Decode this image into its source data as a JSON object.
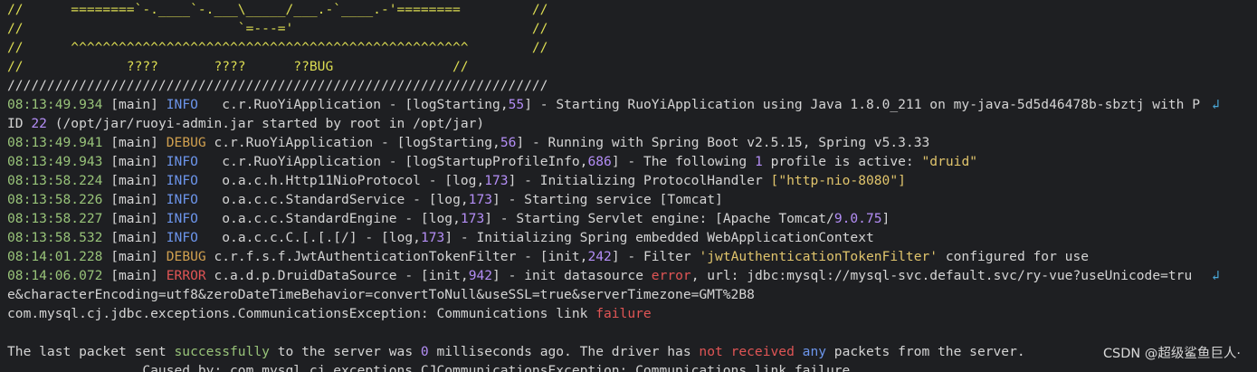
{
  "banner": [
    "//      ========`-.____`-.___\\_____/___.-`____.-'========         //",
    "//                           `=---='                              //",
    "//      ^^^^^^^^^^^^^^^^^^^^^^^^^^^^^^^^^^^^^^^^^^^^^^^^^^        //",
    "//             ????       ????      ??BUG               //",
    "////////////////////////////////////////////////////////////////////"
  ],
  "log": [
    {
      "ts": "08:13:49.934",
      "thread": "[main]",
      "level": "INFO ",
      "logger": "c.r.RuoYiApplication",
      "sep": " - [",
      "method": "logStarting",
      "line": "55",
      "tail": "] - Starting RuoYiApplication using Java 1.8.0_211 on my-java-5d5d46478b-sbztj with P"
    },
    {
      "ts": "08:13:49.941",
      "thread": "[main]",
      "level": "DEBUG",
      "logger": "c.r.RuoYiApplication",
      "sep": " - [",
      "method": "logStarting",
      "line": "56",
      "tail": "] - Running with Spring Boot v2.5.15, Spring v5.3.33"
    },
    {
      "ts": "08:13:49.943",
      "thread": "[main]",
      "level": "INFO ",
      "logger": "c.r.RuoYiApplication",
      "sep": " - [",
      "method": "logStartupProfileInfo",
      "line": "686",
      "tail": "] - The following "
    },
    {
      "ts": "08:13:58.224",
      "thread": "[main]",
      "level": "INFO ",
      "logger": "o.a.c.h.Http11NioProtocol",
      "sep": " - [",
      "method": "log",
      "line": "173",
      "tail": "] - Initializing ProtocolHandler "
    },
    {
      "ts": "08:13:58.226",
      "thread": "[main]",
      "level": "INFO ",
      "logger": "o.a.c.c.StandardService",
      "sep": " - [",
      "method": "log",
      "line": "173",
      "tail": "] - Starting service [Tomcat]"
    },
    {
      "ts": "08:13:58.227",
      "thread": "[main]",
      "level": "INFO ",
      "logger": "o.a.c.c.StandardEngine",
      "sep": " - [",
      "method": "log",
      "line": "173",
      "tail": "] - Starting Servlet engine: [Apache Tomcat/"
    },
    {
      "ts": "08:13:58.532",
      "thread": "[main]",
      "level": "INFO ",
      "logger": "o.a.c.c.C.[.[.[/]",
      "sep": " - [",
      "method": "log",
      "line": "173",
      "tail": "] - Initializing Spring embedded WebApplicationContext"
    },
    {
      "ts": "08:14:01.228",
      "thread": "[main]",
      "level": "DEBUG",
      "logger": "c.r.f.s.f.JwtAuthenticationTokenFilter",
      "sep": " - [",
      "method": "init",
      "line": "242",
      "tail": "] - Filter "
    },
    {
      "ts": "08:14:06.072",
      "thread": "[main]",
      "level": "ERROR",
      "logger": "c.a.d.p.DruidDataSource",
      "sep": " - [",
      "method": "init",
      "line": "942",
      "tail": "] - init datasource "
    }
  ],
  "extra": {
    "pid_cont_a": "ID ",
    "pid": "22",
    "pid_cont_b": " (/opt/jar/ruoyi-admin.jar started by root in /opt/jar)",
    "profile_count": "1",
    "profile_mid": " profile is active: ",
    "profile_name": "\"druid\"",
    "protocol": "[\"http-nio-8080\"]",
    "tomcat_version": "9.0.75",
    "tomcat_close": "]",
    "filter_name": "'jwtAuthenticationTokenFilter'",
    "filter_tail": " configured for use",
    "error_word": "error",
    "error_tail": ", url: jdbc:mysql://mysql-svc.default.svc/ry-vue?useUnicode=tru",
    "url_cont": "e&characterEncoding=utf8&zeroDateTimeBehavior=convertToNull&useSSL=true&serverTimezone=GMT%2B8",
    "exception_class": "com.mysql.cj.jdbc.exceptions.CommunicationsException:",
    "exception_mid": " Communications link ",
    "exception_fail": "failure",
    "packet_a": "The last packet sent ",
    "packet_success": "successfully",
    "packet_b": " to the server was ",
    "packet_zero": "0",
    "packet_c": " milliseconds ago. The driver has ",
    "packet_not": "not received",
    "packet_space": " ",
    "packet_any": "any",
    "packet_d": " packets from the server.",
    "cut_line": "                 Caused by: com.mysql.cj.exceptions.CJCommunicationsException: Communications link failure"
  },
  "wrap_icon": "↲",
  "watermark": "CSDN @超级鲨鱼巨人·"
}
